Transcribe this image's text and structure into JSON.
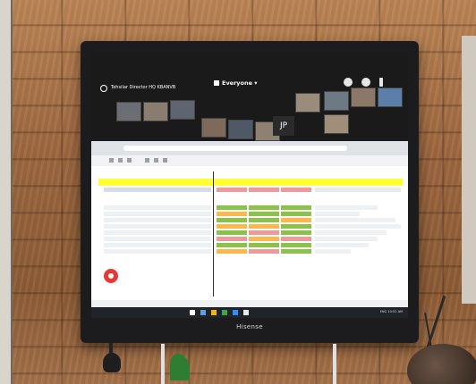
{
  "zoom": {
    "meeting_title": "Tehsilar Director HQ KBANVB",
    "audience_label": "Everyone",
    "presenter_initials": "JP"
  },
  "tv": {
    "brand": "Hisense"
  },
  "colors": {
    "header_highlight": "#ffff33",
    "status_green": "#8bc34a",
    "status_orange": "#ffb74d",
    "status_red": "#ef9a9a",
    "record_button": "#e53935"
  },
  "taskbar": {
    "tray": "ENG 10:52 AM"
  },
  "icons": {
    "back": "back-circle-icon",
    "record": "record-icon",
    "audience": "speaker-icon"
  }
}
